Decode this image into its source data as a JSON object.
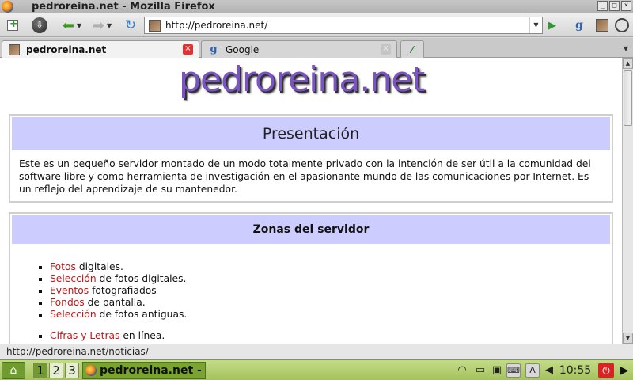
{
  "window": {
    "title": "pedroreina.net - Mozilla Firefox"
  },
  "nav": {
    "url": "http://pedroreina.net/",
    "go_label": "▶",
    "search_engine_icon": "g"
  },
  "tabs": [
    {
      "label": "pedroreina.net",
      "active": true
    },
    {
      "label": "Google",
      "active": false
    }
  ],
  "page": {
    "logo_text": "pedroreina.net",
    "presentacion": {
      "heading": "Presentación",
      "text": "Este es un pequeño servidor montado de un modo totalmente privado con la intención de ser útil a la comunidad del software libre y como herramienta de investigación en el apasionante mundo de las comunicaciones por Internet. Es un reflejo del aprendizaje de su mantenedor."
    },
    "zonas": {
      "heading": "Zonas del servidor",
      "items": [
        {
          "link": "Fotos",
          "rest": " digitales."
        },
        {
          "link": "Selección",
          "rest": " de fotos digitales."
        },
        {
          "link": "Eventos",
          "rest": " fotografiados"
        },
        {
          "link": "Fondos",
          "rest": " de pantalla."
        },
        {
          "link": "Selección",
          "rest": " de fotos antiguas."
        },
        {
          "link": "Cifras y Letras",
          "rest": " en línea."
        }
      ]
    }
  },
  "status": {
    "text": "http://pedroreina.net/noticias/"
  },
  "taskbar": {
    "workspaces": [
      "1",
      "2",
      "3"
    ],
    "current_workspace": "1",
    "task_label": "pedroreina.net -",
    "clock": "10:55"
  },
  "colors": {
    "header_bg": "#ccccff",
    "link": "#c01818",
    "logo": "#7a54c4",
    "taskbar": "#a4c25c"
  }
}
